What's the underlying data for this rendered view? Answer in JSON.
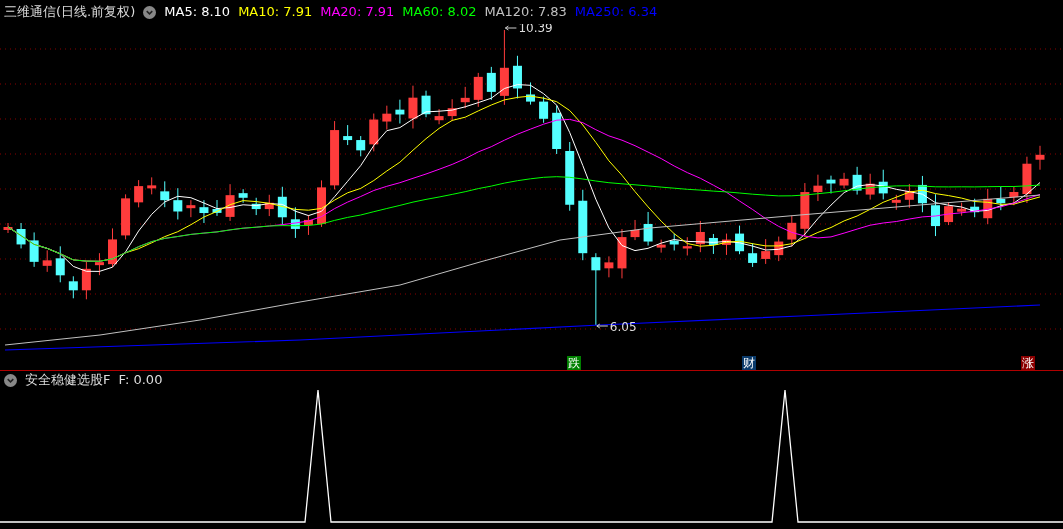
{
  "chart_header": {
    "title": "三维通信(日线.前复权)",
    "moving_averages": [
      {
        "label": "MA5: 8.10",
        "color": "#ffffff"
      },
      {
        "label": "MA10: 7.91",
        "color": "#ffff00"
      },
      {
        "label": "MA20: 7.91",
        "color": "#ff00ff"
      },
      {
        "label": "MA60: 8.02",
        "color": "#00ff00"
      },
      {
        "label": "MA120: 7.83",
        "color": "#c0c0c0"
      },
      {
        "label": "MA250: 6.34",
        "color": "#0000ff"
      }
    ]
  },
  "price_labels": {
    "high": "10.39",
    "low": "6.05"
  },
  "event_markers": [
    {
      "text": "跌",
      "color": "#008000"
    },
    {
      "text": "财",
      "color": "#0a3a6a"
    },
    {
      "text": "涨",
      "color": "#8b0000"
    }
  ],
  "indicator": {
    "title": "安全稳健选股F",
    "value": "F: 0.00"
  }
}
